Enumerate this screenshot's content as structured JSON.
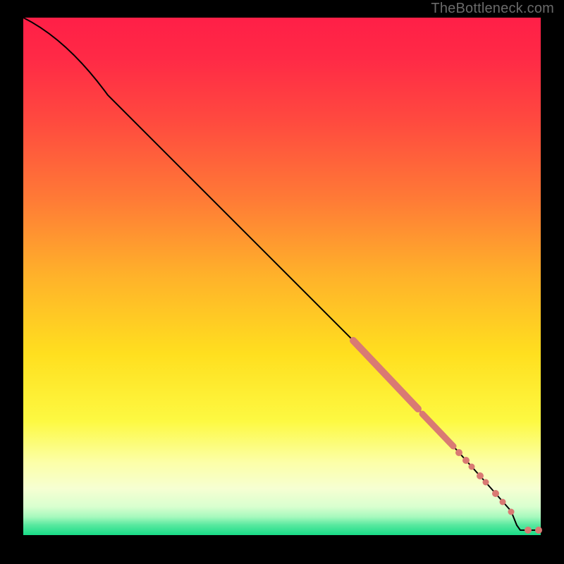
{
  "watermark": "TheBottleneck.com",
  "chart_data": {
    "type": "line",
    "title": "",
    "xlabel": "",
    "ylabel": "",
    "xlim": [
      0,
      100
    ],
    "ylim": [
      0,
      100
    ],
    "background_gradient_meaning": "bottleneck severity (top = high / red, bottom = low / green)",
    "series": [
      {
        "name": "bottleneck-curve",
        "x": [
          0,
          5,
          10,
          16,
          30,
          50,
          65,
          76,
          83,
          89,
          94,
          96,
          97.5,
          99,
          100
        ],
        "y": [
          100,
          98,
          94,
          85,
          70,
          50,
          36,
          24,
          17,
          10,
          5,
          2,
          1,
          1,
          1
        ]
      }
    ],
    "markers": {
      "name": "sampled-configurations",
      "color": "#d97a73",
      "points": [
        {
          "x": 64,
          "y": 37.5
        },
        {
          "x": 66,
          "y": 35
        },
        {
          "x": 68,
          "y": 33
        },
        {
          "x": 70,
          "y": 31
        },
        {
          "x": 72,
          "y": 29
        },
        {
          "x": 74,
          "y": 27
        },
        {
          "x": 76,
          "y": 24.5
        },
        {
          "x": 77.5,
          "y": 23
        },
        {
          "x": 79,
          "y": 21.5
        },
        {
          "x": 81,
          "y": 19
        },
        {
          "x": 83,
          "y": 17
        },
        {
          "x": 84.2,
          "y": 16
        },
        {
          "x": 85.5,
          "y": 14.5
        },
        {
          "x": 86.7,
          "y": 13.2
        },
        {
          "x": 88.3,
          "y": 11.5
        },
        {
          "x": 89.4,
          "y": 10.2
        },
        {
          "x": 91.3,
          "y": 8
        },
        {
          "x": 92.6,
          "y": 6.4
        },
        {
          "x": 94.3,
          "y": 4.5
        },
        {
          "x": 97.5,
          "y": 1
        },
        {
          "x": 99.6,
          "y": 1
        }
      ]
    }
  }
}
